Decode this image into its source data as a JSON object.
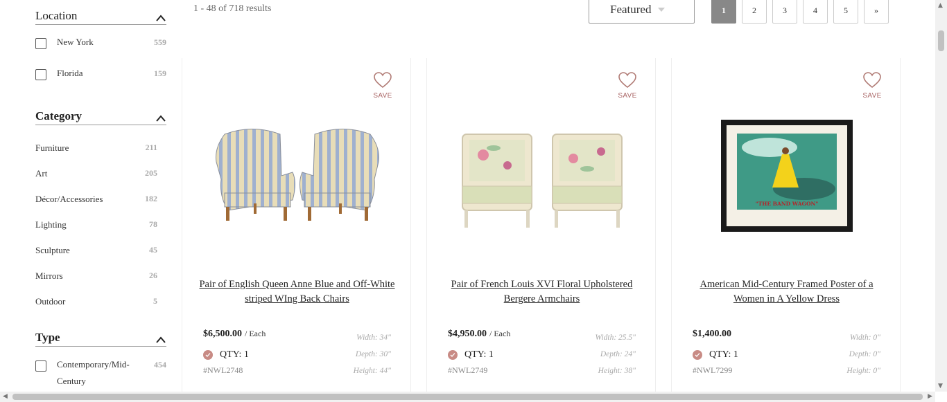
{
  "sidebar": {
    "location": {
      "title": "Location",
      "items": [
        {
          "label": "New York",
          "count": "559"
        },
        {
          "label": "Florida",
          "count": "159"
        }
      ]
    },
    "category": {
      "title": "Category",
      "items": [
        {
          "label": "Furniture",
          "count": "211"
        },
        {
          "label": "Art",
          "count": "205"
        },
        {
          "label": "Décor/Accessories",
          "count": "182"
        },
        {
          "label": "Lighting",
          "count": "78"
        },
        {
          "label": "Sculpture",
          "count": "45"
        },
        {
          "label": "Mirrors",
          "count": "26"
        },
        {
          "label": "Outdoor",
          "count": "5"
        }
      ]
    },
    "type": {
      "title": "Type",
      "items": [
        {
          "label": "Contemporary/Mid-Century",
          "count": "454"
        }
      ]
    }
  },
  "toolbar": {
    "results_text": "1 - 48 of 718 results",
    "sort_value": "Featured",
    "pages": [
      "1",
      "2",
      "3",
      "4",
      "5",
      "»"
    ],
    "active_page": "1"
  },
  "products": [
    {
      "save_label": "SAVE",
      "title": "Pair of English Queen Anne Blue and Off-White striped WIng Back Chairs",
      "price": "$6,500.00",
      "unit": "/ Each",
      "qty": "QTY: 1",
      "sku": "#NWL2748",
      "width": "Width: 34\"",
      "depth": "Depth: 30\"",
      "height": "Height: 44\""
    },
    {
      "save_label": "SAVE",
      "title": "Pair of French Louis XVI Floral Upholstered Bergere Armchairs",
      "price": "$4,950.00",
      "unit": "/ Each",
      "qty": "QTY: 1",
      "sku": "#NWL2749",
      "width": "Width: 25.5\"",
      "depth": "Depth: 24\"",
      "height": "Height: 38\""
    },
    {
      "save_label": "SAVE",
      "title": "American Mid-Century Framed Poster of a Women in A Yellow Dress",
      "price": "$1,400.00",
      "unit": "",
      "qty": "QTY: 1",
      "sku": "#NWL7299",
      "width": "Width: 0\"",
      "depth": "Depth: 0\"",
      "height": "Height: 0\"",
      "poster_caption": "\"THE BAND WAGON\""
    }
  ],
  "colors": {
    "accent": "#c88b85",
    "active_page": "#888888"
  }
}
